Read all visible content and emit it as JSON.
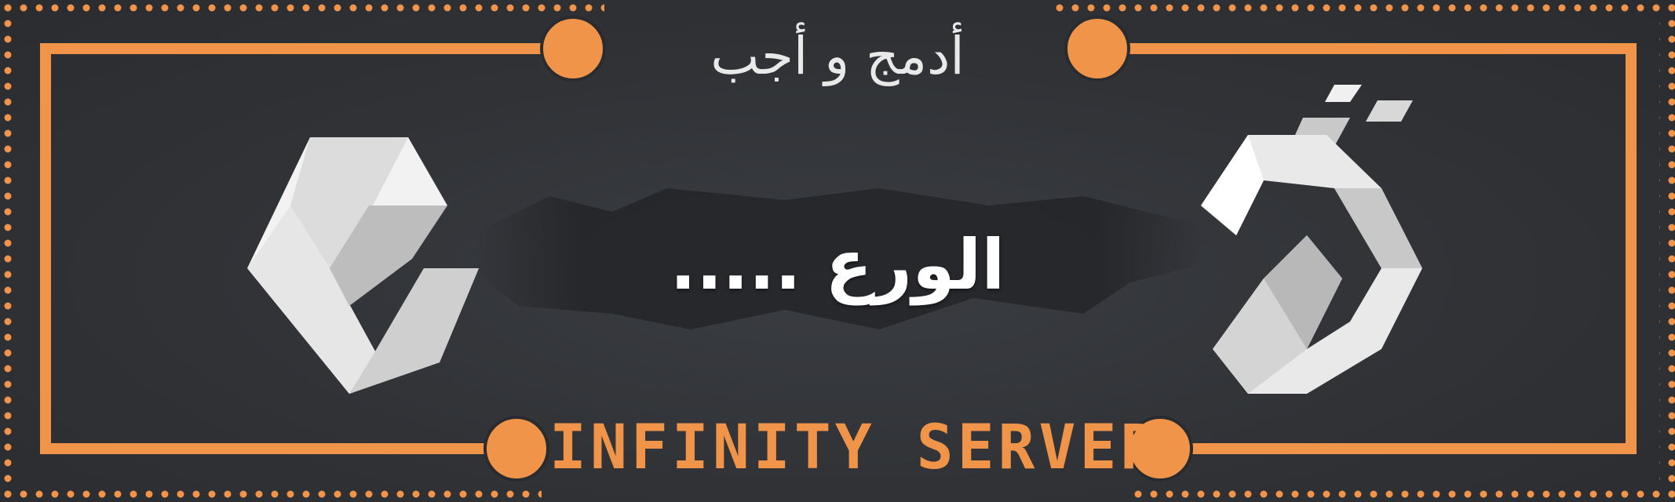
{
  "banner": {
    "top_title": "أدمج و أجب",
    "main_title": "الورع .....",
    "server_name": "INFINITY SERVER"
  },
  "icons": {
    "left_logo": "infinity-hexagon-logo-icon",
    "right_logo": "infinity-hexagon-logo-alt-icon"
  },
  "colors": {
    "background": "#303236",
    "accent_orange": "#f0944a",
    "title_white": "#ffffff",
    "logo_light": "#f2f2f2",
    "logo_shade": "#bdbdbd"
  }
}
